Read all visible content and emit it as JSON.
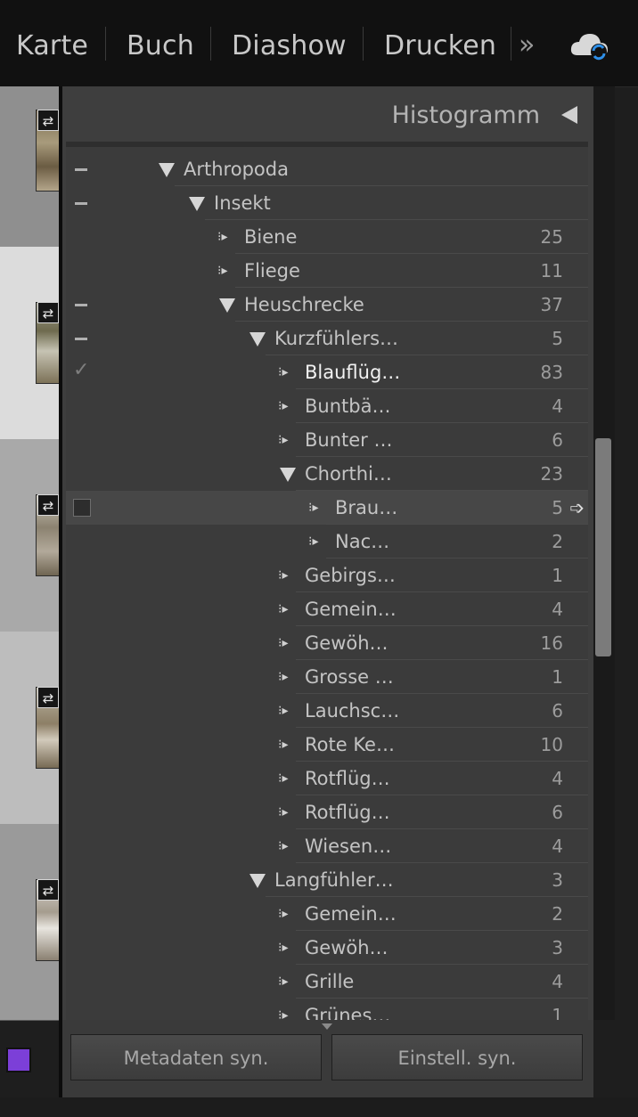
{
  "modules": [
    "Karte",
    "Buch",
    "Diashow",
    "Drucken"
  ],
  "more_icon": "»",
  "panel": {
    "title": "Histogramm",
    "title_icon": "collapse-triangle-icon"
  },
  "keywords": [
    {
      "label": "Arthropoda",
      "count": "",
      "state": "expanded",
      "mark": "minus"
    },
    {
      "label": "Insekt",
      "count": "",
      "state": "expanded",
      "mark": "minus"
    },
    {
      "label": "Biene",
      "count": "25",
      "state": "leaf",
      "mark": ""
    },
    {
      "label": "Fliege",
      "count": "11",
      "state": "leaf",
      "mark": ""
    },
    {
      "label": "Heuschrecke",
      "count": "37",
      "state": "expanded",
      "mark": "minus"
    },
    {
      "label": "Kurzfühlers…",
      "count": "5",
      "state": "expanded",
      "mark": "minus"
    },
    {
      "label": "Blauflüg…",
      "count": "83",
      "state": "leaf",
      "mark": "check"
    },
    {
      "label": "Buntbä…",
      "count": "4",
      "state": "leaf",
      "mark": ""
    },
    {
      "label": "Bunter …",
      "count": "6",
      "state": "leaf",
      "mark": ""
    },
    {
      "label": "Chorthi…",
      "count": "23",
      "state": "expanded",
      "mark": ""
    },
    {
      "label": "Brau…",
      "count": "5",
      "state": "leaf",
      "mark": "box"
    },
    {
      "label": "Nac…",
      "count": "2",
      "state": "leaf",
      "mark": ""
    },
    {
      "label": "Gebirgs…",
      "count": "1",
      "state": "leaf",
      "mark": ""
    },
    {
      "label": "Gemein…",
      "count": "4",
      "state": "leaf",
      "mark": ""
    },
    {
      "label": "Gewöh…",
      "count": "16",
      "state": "leaf",
      "mark": ""
    },
    {
      "label": "Grosse …",
      "count": "1",
      "state": "leaf",
      "mark": ""
    },
    {
      "label": "Lauchsc…",
      "count": "6",
      "state": "leaf",
      "mark": ""
    },
    {
      "label": "Rote Ke…",
      "count": "10",
      "state": "leaf",
      "mark": ""
    },
    {
      "label": "Rotflüg…",
      "count": "4",
      "state": "leaf",
      "mark": ""
    },
    {
      "label": "Rotflüg…",
      "count": "6",
      "state": "leaf",
      "mark": ""
    },
    {
      "label": "Wiesen…",
      "count": "4",
      "state": "leaf",
      "mark": ""
    },
    {
      "label": "Langfühler…",
      "count": "3",
      "state": "expanded",
      "mark": ""
    },
    {
      "label": "Gemein…",
      "count": "2",
      "state": "leaf",
      "mark": ""
    },
    {
      "label": "Gewöh…",
      "count": "3",
      "state": "leaf",
      "mark": ""
    },
    {
      "label": "Grille",
      "count": "4",
      "state": "leaf",
      "mark": ""
    },
    {
      "label": "Grünes…",
      "count": "1",
      "state": "leaf",
      "mark": ""
    }
  ],
  "buttons": {
    "sync_metadata": "Metadaten syn.",
    "sync_settings": "Einstell. syn."
  },
  "colors": {
    "swatch": "#7c3fd8"
  }
}
